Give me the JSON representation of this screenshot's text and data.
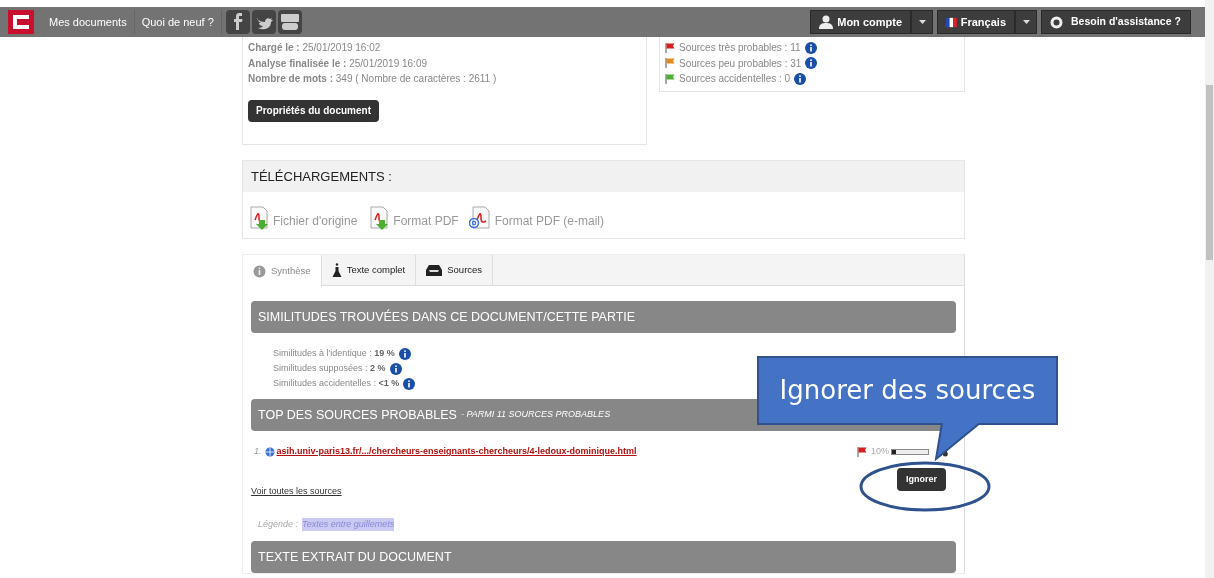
{
  "navbar": {
    "links": [
      "Mes documents",
      "Quoi de neuf ?"
    ],
    "account": "Mon compte",
    "language": "Français",
    "help": "Besoin d'assistance ?"
  },
  "document_info": [
    {
      "label": "Chargé le :",
      "value": "25/01/2019 16:02"
    },
    {
      "label": "Analyse finalisée le :",
      "value": "25/01/2019 16:09"
    },
    {
      "label": "Nombre de mots :",
      "value": "349 ( Nombre de caractères : 2611 )"
    }
  ],
  "properties_button": "Propriétés du document",
  "source_counts": [
    {
      "label": "Sources très probables : 11",
      "color": "#d42020"
    },
    {
      "label": "Sources peu probables : 31",
      "color": "#e08a1e"
    },
    {
      "label": "Sources accidentelles : 0",
      "color": "#4caf32"
    }
  ],
  "downloads": {
    "title": "TÉLÉCHARGEMENTS :",
    "items": [
      {
        "label": "Fichier d'origine",
        "kind": "download"
      },
      {
        "label": "Format PDF",
        "kind": "download"
      },
      {
        "label": "Format PDF (e-mail)",
        "kind": "email"
      }
    ]
  },
  "tabs": [
    {
      "label": "Synthèse",
      "selected": true,
      "kind": "info"
    },
    {
      "label": "Texte complet",
      "selected": false,
      "kind": "flask"
    },
    {
      "label": "Sources",
      "selected": false,
      "kind": "tray"
    }
  ],
  "similarities": {
    "title": "SIMILITUDES TROUVÉES DANS CE DOCUMENT/CETTE PARTIE",
    "items": [
      {
        "label": "Similitudes à l'identique :",
        "value": "19 %"
      },
      {
        "label": "Similitudes supposées :",
        "value": "2 %"
      },
      {
        "label": "Similitudes accidentelles :",
        "value": "<1 %"
      }
    ]
  },
  "top_sources": {
    "title": "TOP DES SOURCES PROBABLES",
    "subtitle": "- PARMI 11 SOURCES PROBABLES",
    "rows": [
      {
        "number": "1.",
        "url": "asih.univ-paris13.fr/.../chercheurs-enseignants-chercheurs/4-ledoux-dominique.html",
        "percent": "10%",
        "level": 0.1
      }
    ],
    "ignore_button": "Ignorer",
    "see_all": "Voir toutes les sources"
  },
  "legend": {
    "label": "Légende :",
    "item": "Textes entre guillemets"
  },
  "extract_title": "TEXTE EXTRAIT DU DOCUMENT",
  "callout": "Ignorer des sources"
}
